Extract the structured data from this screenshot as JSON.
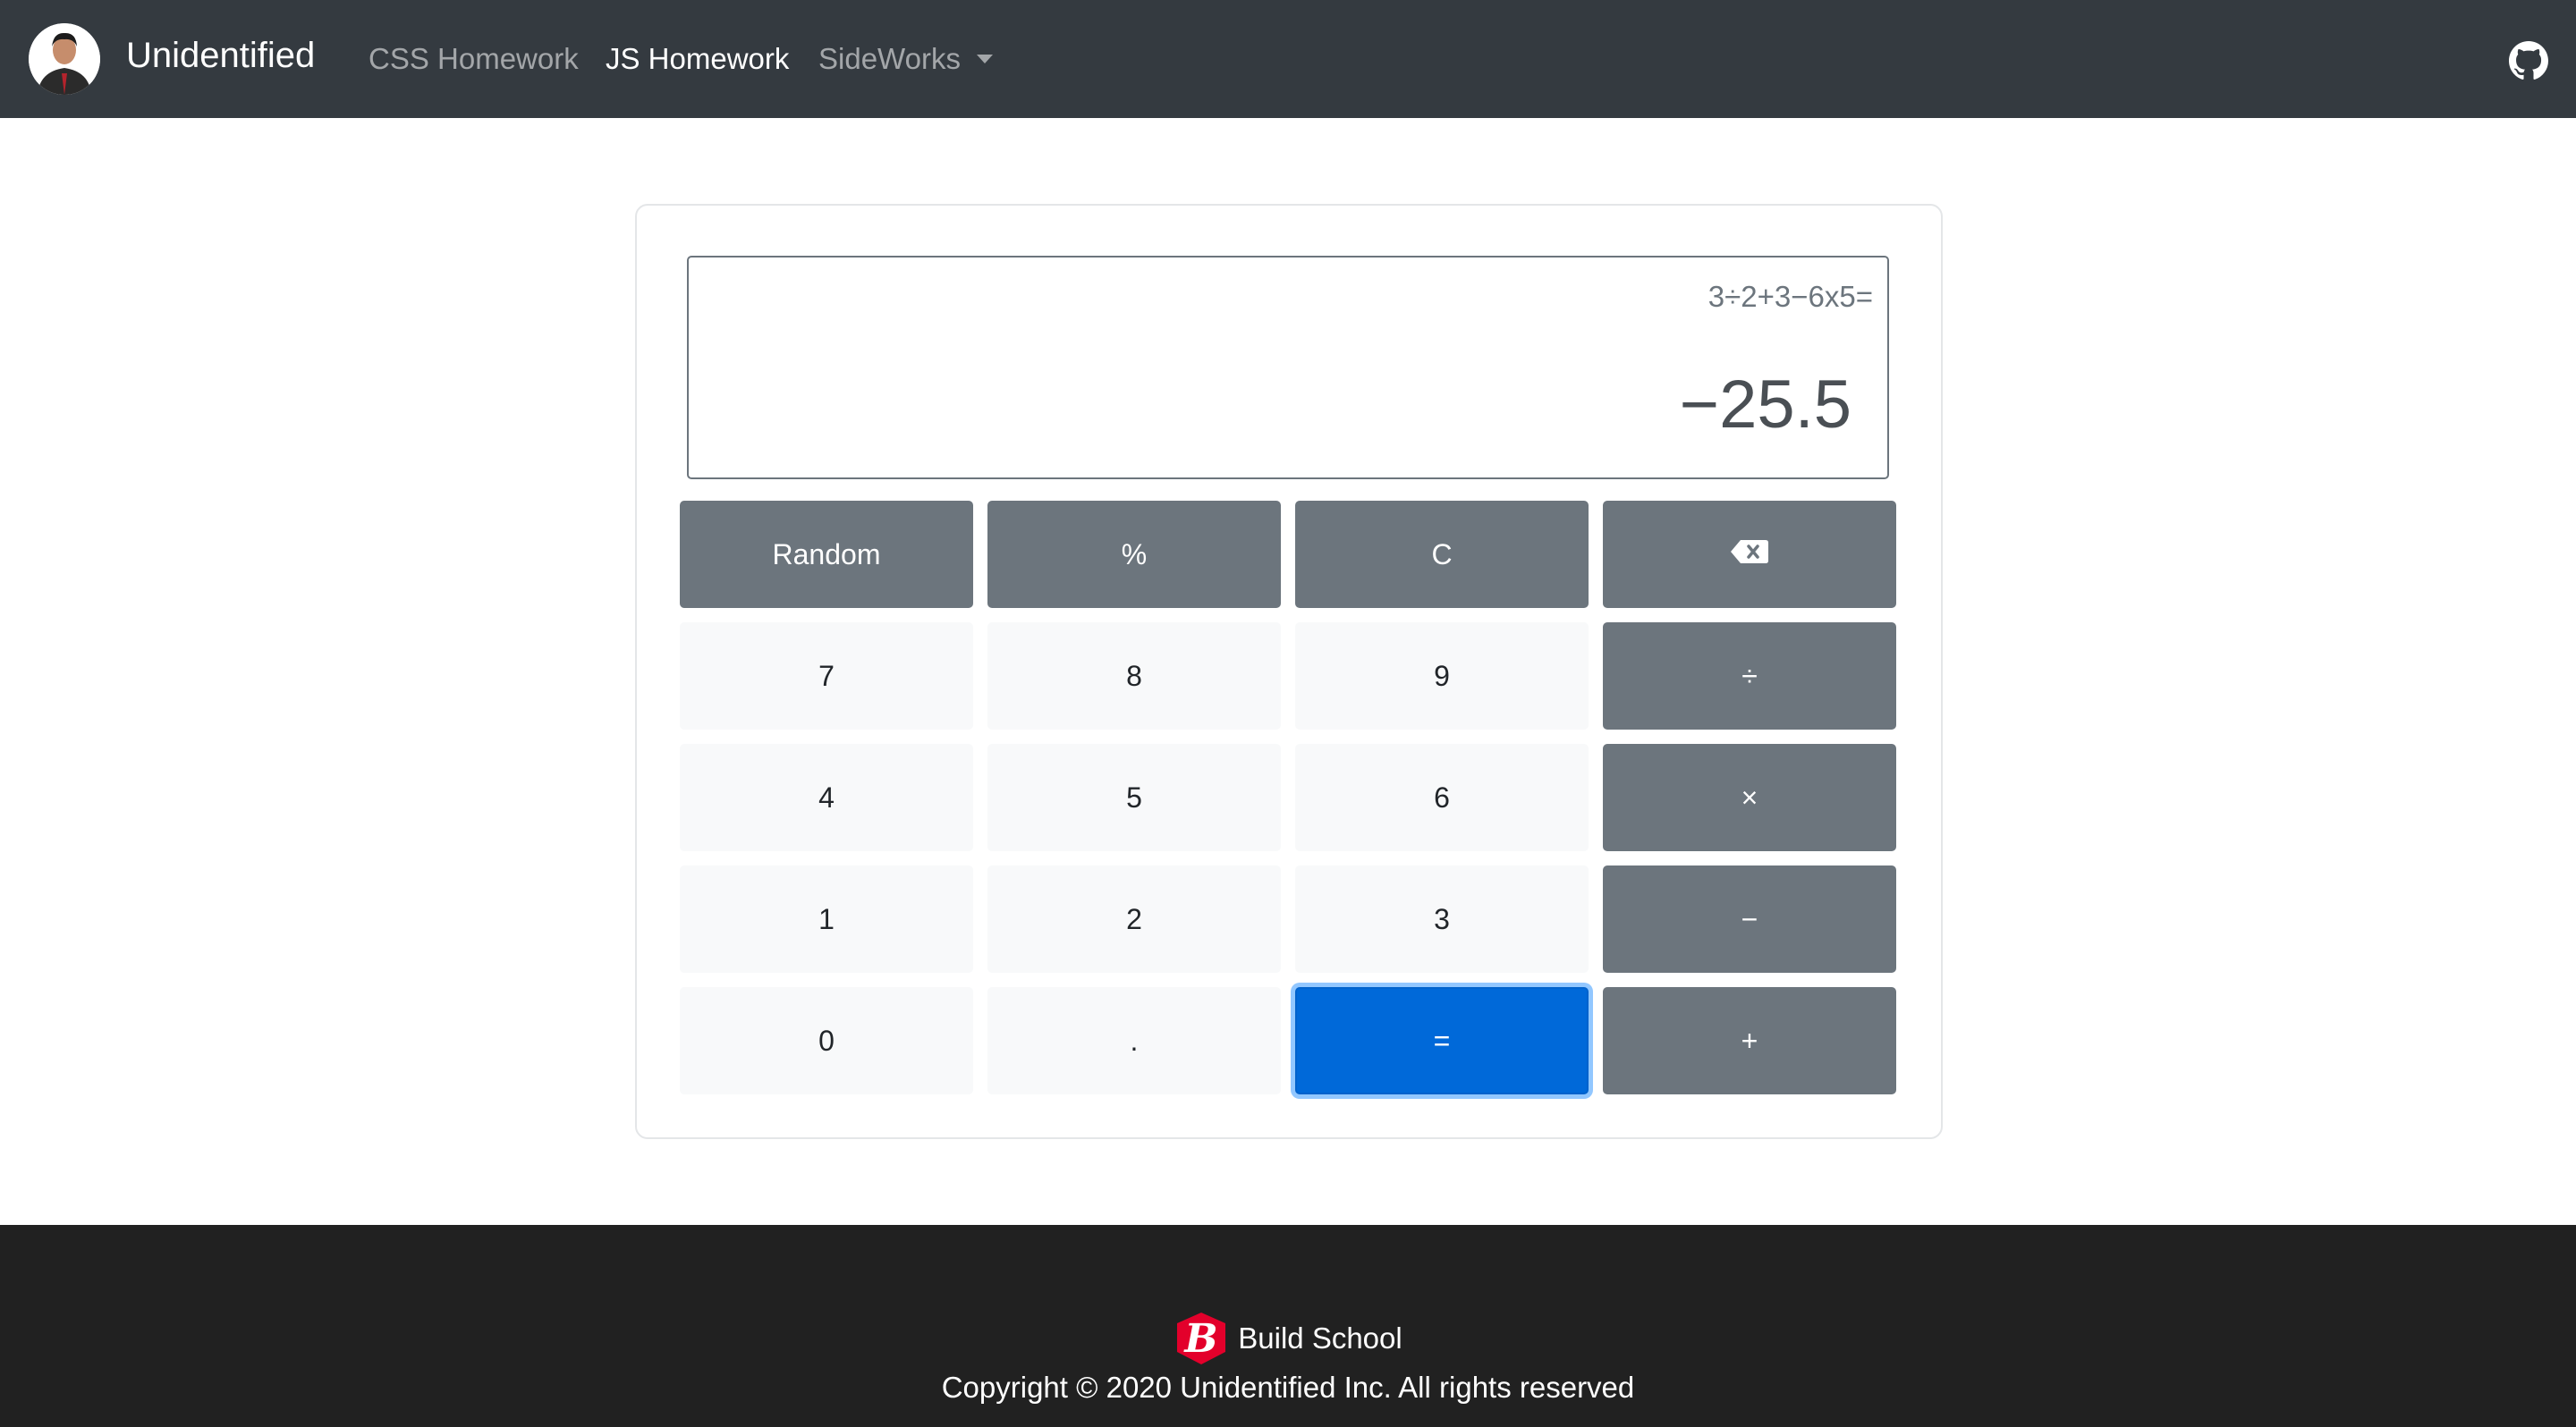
{
  "navbar": {
    "brand": "Unidentified",
    "links": [
      {
        "label": "CSS Homework",
        "active": false
      },
      {
        "label": "JS Homework",
        "active": true
      },
      {
        "label": "SideWorks",
        "active": false,
        "dropdown": true
      }
    ],
    "right_icon": "github-icon"
  },
  "calculator": {
    "expression": "3÷2+3−6x5=",
    "result": "−25.5",
    "keys": [
      [
        "Random",
        "%",
        "C",
        "backspace-icon"
      ],
      [
        "7",
        "8",
        "9",
        "÷"
      ],
      [
        "4",
        "5",
        "6",
        "×"
      ],
      [
        "1",
        "2",
        "3",
        "−"
      ],
      [
        "0",
        ".",
        "=",
        "+"
      ]
    ]
  },
  "footer": {
    "school": "Build School",
    "copyright": "Copyright © 2020 Unidentified Inc. All rights reserved"
  },
  "colors": {
    "navbar": "#343a40",
    "footer": "#212121",
    "key_dark": "#6c757d",
    "key_light": "#f8f9fa",
    "key_primary": "#0069d9",
    "logo_red": "#e3002b"
  }
}
